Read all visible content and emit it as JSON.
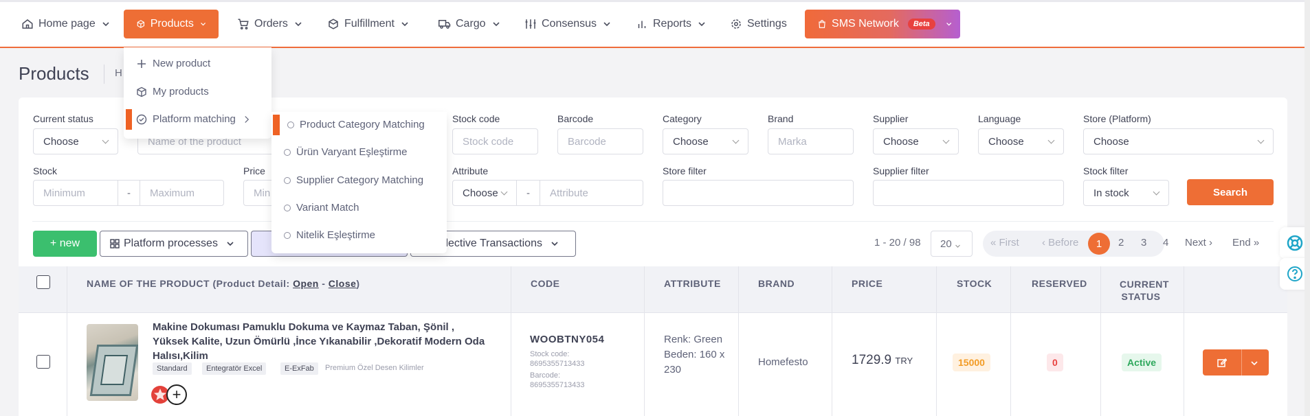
{
  "nav": {
    "home": "Home page",
    "products": "Products",
    "orders": "Orders",
    "fulfillment": "Fulfillment",
    "cargo": "Cargo",
    "consensus": "Consensus",
    "reports": "Reports",
    "settings": "Settings",
    "sms": "SMS Network",
    "beta": "Beta"
  },
  "page": {
    "title": "Products",
    "crumb": "H"
  },
  "products_menu": {
    "new_product": "New product",
    "my_products": "My products",
    "platform_matching": "Platform matching"
  },
  "platform_submenu": [
    "Product Category Matching",
    "Ürün Varyant Eşleştirme",
    "Supplier Category Matching",
    "Variant Match",
    "Nitelik Eşleştirme"
  ],
  "filters": {
    "current_status": {
      "label": "Current status",
      "value": "Choose"
    },
    "name_placeholder": "Name of the product",
    "stock_code": {
      "label": "Stock code",
      "placeholder": "Stock code"
    },
    "barcode": {
      "label": "Barcode",
      "placeholder": "Barcode"
    },
    "category": {
      "label": "Category",
      "value": "Choose"
    },
    "brand": {
      "label": "Brand",
      "placeholder": "Marka"
    },
    "supplier": {
      "label": "Supplier",
      "value": "Choose"
    },
    "language": {
      "label": "Language",
      "value": "Choose"
    },
    "store": {
      "label": "Store (Platform)",
      "value": "Choose"
    },
    "stock": {
      "label": "Stock",
      "min": "Minimum",
      "sep": "-",
      "max": "Maximum"
    },
    "price": {
      "label": "Price",
      "min": "Min"
    },
    "attribute": {
      "label": "Attribute",
      "value": "Choose",
      "sep": "-",
      "placeholder": "Attribute"
    },
    "store_filter": {
      "label": "Store filter"
    },
    "supplier_filter": {
      "label": "Supplier filter"
    },
    "stock_filter": {
      "label": "Stock filter",
      "value": "In stock"
    },
    "search": "Search"
  },
  "actions": {
    "new": "+ new",
    "platform_processes": "Platform processes",
    "collective": "ollective Transactions"
  },
  "pagination": {
    "info": "1 - 20 / 98",
    "page_size": "20",
    "first": "« First",
    "before": "‹ Before",
    "pages": [
      "1",
      "2",
      "3",
      "4"
    ],
    "next": "Next ›",
    "end": "End »"
  },
  "table": {
    "headers": {
      "name_prefix": "NAME OF THE PRODUCT (Product Detail:",
      "open": "Open",
      "dash": "-",
      "close": "Close",
      "close_paren": ")",
      "code": "CODE",
      "attribute": "ATTRIBUTE",
      "brand": "BRAND",
      "price": "PRICE",
      "stock": "STOCK",
      "reserved": "RESERVED",
      "status_line1": "CURRENT",
      "status_line2": "STATUS"
    },
    "rows": [
      {
        "name": "Makine Dokuması Pamuklu Dokuma ve Kaymaz Taban, Şönil , Yüksek Kalite, Uzun Ömürlü ,İnce Yıkanabilir ,Dekoratif Modern Oda Halısı,Kilim",
        "tags": [
          "Standard",
          "Entegratör Excel",
          "E-ExFab"
        ],
        "extra_tag": "Premium Özel Desen Kilimler",
        "code": "WOOBTNY054",
        "stock_code_label": "Stock code:",
        "stock_code": "8695355713433",
        "barcode_label": "Barcode:",
        "barcode": "8695355713433",
        "attribute": "Renk: Green Beden: 160 x 230",
        "brand": "Homefesto",
        "price": "1729.9",
        "currency": "TRY",
        "stock": "15000",
        "reserved": "0",
        "status": "Active"
      }
    ]
  },
  "colors": {
    "accent": "#ee6e35",
    "green": "#3bbf6e",
    "stock_badge": "#fff1e0",
    "reserved_badge": "#fde8ea",
    "active_badge": "#e6f7ec"
  }
}
